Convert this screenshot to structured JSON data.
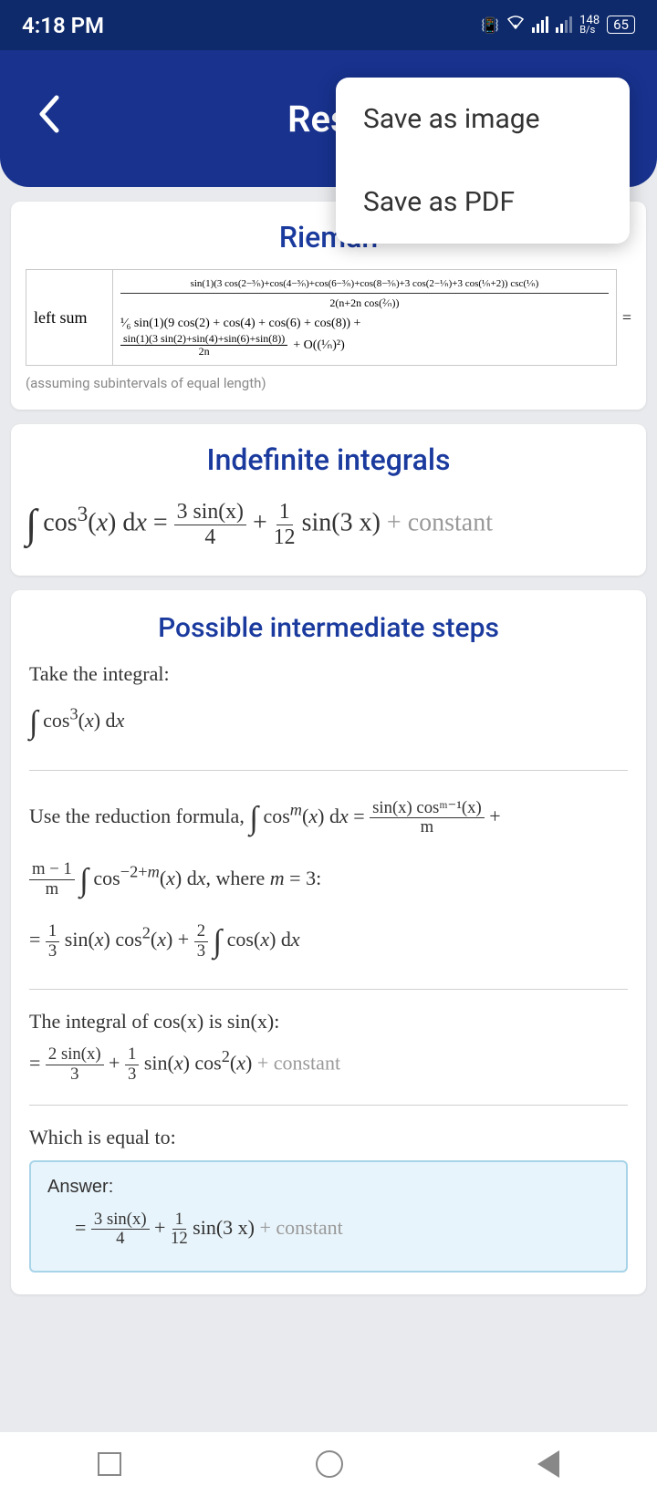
{
  "status": {
    "time": "4:18 PM",
    "data_rate": "148",
    "data_unit": "B/s",
    "battery": "65"
  },
  "header": {
    "title": "Resu"
  },
  "popup": {
    "save_image": "Save as image",
    "save_pdf": "Save as PDF"
  },
  "riemann": {
    "title": "Rieman",
    "left_label": "left sum",
    "formula_line1": "sin(1)(3 cos(2−³⁄ₙ)+cos(4−³⁄ₙ)+cos(6−³⁄ₙ)+cos(8−³⁄ₙ)+3 cos(2−¹⁄ₙ)+3 cos(¹⁄ₙ+2)) csc(¹⁄ₙ)",
    "formula_line2": "2(n+2n cos(²⁄ₙ))",
    "formula_line3": "¹⁄₆ sin(1)(9 cos(2) + cos(4) + cos(6) + cos(8)) +",
    "formula_line4": "sin(1)(3 sin(2)+sin(4)+sin(6)+sin(8))",
    "formula_line5": "2n",
    "formula_line6": "+ O((¹⁄ₙ)²)",
    "equals": "=",
    "note": "(assuming subintervals of equal length)"
  },
  "indefinite": {
    "title": "Indefinite integrals",
    "lhs": "∫ cos³(x) dx =",
    "rhs_frac1_num": "3 sin(x)",
    "rhs_frac1_den": "4",
    "plus": "+",
    "rhs_frac2_num": "1",
    "rhs_frac2_den": "12",
    "rhs_tail": "sin(3 x)",
    "constant": " + constant"
  },
  "steps": {
    "title": "Possible intermediate steps",
    "step1_text": "Take the integral:",
    "step1_math": "∫ cos³(x) dx",
    "step2_text_a": "Use the reduction formula, ",
    "step2_text_b": "∫ cosᵐ(x) dx =",
    "step2_rhs_num": "sin(x) cosᵐ⁻¹(x)",
    "step2_rhs_den": "m",
    "step2_plus": "+",
    "step2_line2_frac_num": "m − 1",
    "step2_line2_frac_den": "m",
    "step2_line2_tail": "∫ cos⁻²⁺ᵐ(x) dx, where m = 3:",
    "step2_result_a": "= ¹⁄₃ sin(x) cos²(x) + ²⁄₃ ∫ cos(x) dx",
    "step3_text": "The integral of cos(x) is sin(x):",
    "step3_math_a": "=",
    "step3_frac1_num": "2 sin(x)",
    "step3_frac1_den": "3",
    "step3_plus": "+ ¹⁄₃ sin(x) cos²(x)",
    "step3_constant": " + constant",
    "step4_text": "Which is equal to:",
    "answer_label": "Answer:",
    "answer_eq": "=",
    "answer_f1_num": "3 sin(x)",
    "answer_f1_den": "4",
    "answer_plus": "+",
    "answer_f2_num": "1",
    "answer_f2_den": "12",
    "answer_tail": "sin(3 x)",
    "answer_constant": " + constant"
  }
}
